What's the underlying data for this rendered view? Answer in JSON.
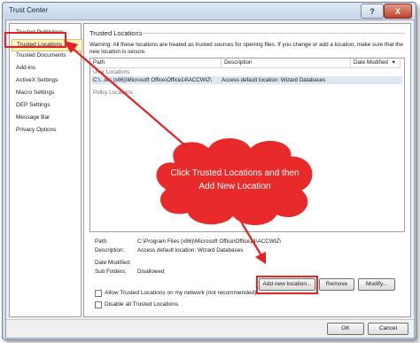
{
  "window": {
    "title": "Trust Center",
    "help_label": "?",
    "close_label": "X"
  },
  "nav": {
    "items": [
      {
        "label": "Trusted Publishers"
      },
      {
        "label": "Trusted Locations",
        "selected": true
      },
      {
        "label": "Trusted Documents"
      },
      {
        "label": "Add-ins"
      },
      {
        "label": "ActiveX Settings"
      },
      {
        "label": "Macro Settings"
      },
      {
        "label": "DEP Settings"
      },
      {
        "label": "Message Bar"
      },
      {
        "label": "Privacy Options"
      }
    ]
  },
  "content": {
    "section_title": "Trusted Locations",
    "warning": "Warning: All these locations are treated as trusted sources for opening files.  If you change or add a location, make sure that the new location is secure.",
    "table": {
      "columns": {
        "path": "Path",
        "description": "Description",
        "date_modified": "Date Modified"
      },
      "sort_indicator": "▾",
      "group_user": "User Locations",
      "row_path": "C:\\...les (x86)\\Microsoft Office\\Office14\\ACCWIZ\\",
      "row_description": "Access default location: Wizard Databases",
      "group_policy": "Policy Locations"
    },
    "details": {
      "path_label": "Path:",
      "path_value": "C:\\Program Files (x86)\\Microsoft Office\\Office14\\ACCWIZ\\",
      "description_label": "Description:",
      "description_value": "Access default location: Wizard Databases",
      "date_label": "Date Modified:",
      "date_value": "",
      "subfolders_label": "Sub Folders:",
      "subfolders_value": "Disallowed"
    },
    "buttons": {
      "add": "Add new location...",
      "remove": "Remove",
      "modify": "Modify..."
    },
    "checkboxes": {
      "allow_network": "Allow Trusted Locations on my network (not recommended)",
      "disable_all": "Disable all Trusted Locations"
    }
  },
  "footer": {
    "ok": "OK",
    "cancel": "Cancel"
  },
  "callout": {
    "text": "Click Trusted Locations and then Add New Location"
  },
  "colors": {
    "callout_fill": "#e82a2a",
    "highlight": "#e52222",
    "selection": "#fff3c4"
  }
}
